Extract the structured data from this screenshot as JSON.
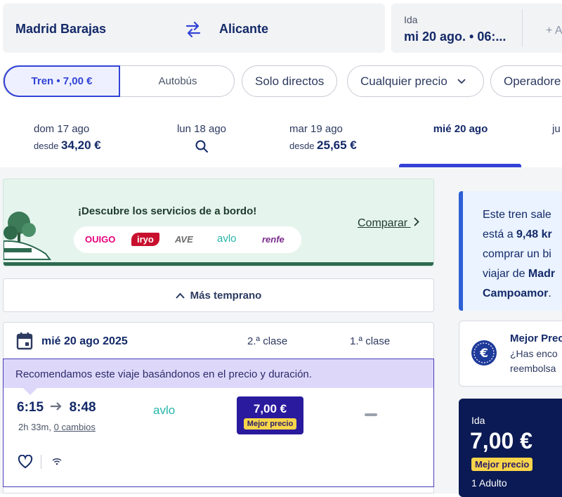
{
  "search": {
    "from": "Madrid Barajas",
    "to": "Alicante",
    "date_label": "Ida",
    "date_value": "mi 20 ago. • 06:...",
    "add_label": "+ A"
  },
  "filters": {
    "mode_selected": "Tren • 7,00 €",
    "mode_other": "Autobús",
    "direct": "Solo directos",
    "price": "Cualquier precio",
    "operators": "Operadore"
  },
  "date_tabs": [
    {
      "day": "dom 17 ago",
      "prefix": "desde",
      "price": "34,20 €"
    },
    {
      "day": "lun 18 ago",
      "prefix": "",
      "price": ""
    },
    {
      "day": "mar 19 ago",
      "prefix": "desde",
      "price": "25,65 €"
    },
    {
      "day": "mié 20 ago",
      "prefix": "",
      "price": ""
    },
    {
      "day": "ju",
      "prefix": "",
      "price": ""
    }
  ],
  "promo": {
    "title": "¡Descubre los servicios de a bordo!",
    "compare": "Comparar",
    "logos": [
      "OUIGO",
      "iryo",
      "AVE",
      "avlo",
      "renfe"
    ]
  },
  "earlier": "Más temprano",
  "results": {
    "date": "mié 20 ago 2025",
    "class2": "2.ª clase",
    "class1": "1.ª clase",
    "recommend": "Recomendamos este viaje basándonos en el precio y duración.",
    "trip": {
      "depart": "6:15",
      "arrive": "8:48",
      "duration": "2h 33m,",
      "changes": "0 cambios",
      "operator": "avlo",
      "price": "7,00 €",
      "badge": "Mejor precio"
    }
  },
  "sidebar": {
    "info_l1": "Este tren sale",
    "info_l2a": "está a ",
    "info_l2b": "9,48 kr",
    "info_l3": "comprar un bi",
    "info_l4a": "viajar de ",
    "info_l4b": "Madr",
    "info_l5": "Campoamor",
    "info_l5c": ".",
    "best_title": "Mejor Prec",
    "best_l1": "¿Has enco",
    "best_l2": "reembolsa",
    "summary_label": "Ida",
    "summary_price": "7,00 €",
    "summary_badge": "Mejor precio",
    "summary_pax": "1 Adulto"
  },
  "colors": {
    "accent": "#3243d6",
    "navy": "#132968",
    "purple": "#2a1a9e",
    "yellow": "#f7d54a",
    "green": "#2d6a50"
  }
}
